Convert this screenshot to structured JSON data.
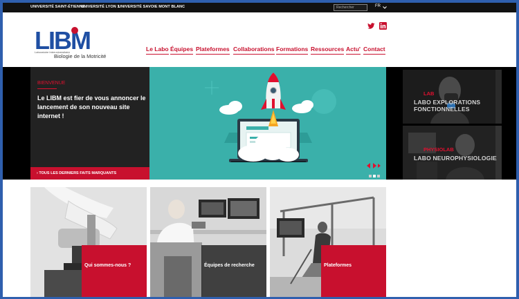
{
  "topbar": {
    "universities": [
      "UNIVERSITÉ SAINT-ÉTIENNE",
      "UNIVERSITÉ LYON 1",
      "UNIVERSITÉ SAVOIE MONT BLANC"
    ],
    "search_placeholder": "Rechercher",
    "language": "FR"
  },
  "logo": {
    "text": "LIBM",
    "sub_small": "Laboratoire Interuniversitaire",
    "sub_main": "Biologie de la Motricité"
  },
  "nav": [
    "Le Labo",
    "Équipes",
    "Plateformes",
    "Collaborations",
    "Formations",
    "Ressources",
    "Actu'",
    "Contact"
  ],
  "hero": {
    "kicker": "BIENVENUE",
    "headline": "Le LIBM est fier de vous annoncer le lancement de son nouveau site internet !",
    "more_link": "TOUS LES DERNIERS FAITS MARQUANTS",
    "slide_count": 3,
    "active_slide": 1
  },
  "side_tiles": [
    {
      "tag": "LAB",
      "title": "LABO EXPLORATIONS FONCTIONNELLES"
    },
    {
      "tag": "PHYSIOLAB",
      "title": "LABO NEUROPHYSIOLOGIE"
    }
  ],
  "cards": [
    {
      "title": "Qui sommes-nous ?"
    },
    {
      "title": "Équipes de recherche"
    },
    {
      "title": "Plateformes"
    }
  ],
  "colors": {
    "brand_red": "#c8102e",
    "teal": "#3ab0aa",
    "border_blue": "#2f5fae",
    "logo_blue": "#1f4fa3"
  }
}
